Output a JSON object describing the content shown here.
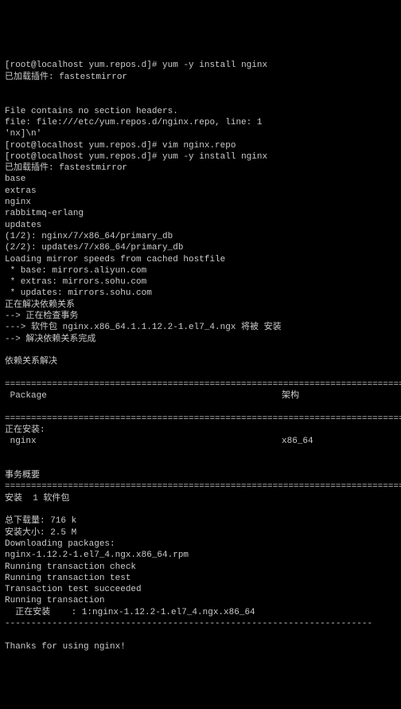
{
  "prompt1": "[root@localhost yum.repos.d]# ",
  "cmd1": "yum -y install nginx",
  "loaded_plugins": "已加载插件: fastestmirror",
  "blank": "",
  "file_no_section": "File contains no section headers.",
  "file_line": "file: file:///etc/yum.repos.d/nginx.repo, line: 1",
  "nx_line": "'nx]\\n'",
  "prompt2": "[root@localhost yum.repos.d]# ",
  "cmd2": "vim nginx.repo",
  "prompt3": "[root@localhost yum.repos.d]# ",
  "cmd3": "yum -y install nginx",
  "loaded_plugins2": "已加载插件: fastestmirror",
  "repo_base": "base",
  "repo_extras": "extras",
  "repo_nginx": "nginx",
  "repo_rabbitmq": "rabbitmq-erlang",
  "repo_updates": "updates",
  "primary1": "(1/2): nginx/7/x86_64/primary_db",
  "primary2": "(2/2): updates/7/x86_64/primary_db",
  "loading_mirror": "Loading mirror speeds from cached hostfile",
  "mirror_base": " * base: mirrors.aliyun.com",
  "mirror_extras": " * extras: mirrors.sohu.com",
  "mirror_updates": " * updates: mirrors.sohu.com",
  "resolving_deps": "正在解决依赖关系",
  "check_trans": "--> 正在检查事务",
  "pkg_install": "---> 软件包 nginx.x86_64.1.1.12.2-1.el7_4.ngx 将被 安装",
  "dep_done": "--> 解决依赖关系完成",
  "deps_resolved": "依赖关系解决",
  "hr_line": "=====================================================================================",
  "col_package": " Package",
  "col_arch": "架构",
  "installing": "正在安装:",
  "pkg_name": " nginx",
  "pkg_arch": "x86_64",
  "trans_summary": "事务概要",
  "install_count": "安装  1 软件包",
  "total_download": "总下载量: 716 k",
  "install_size": "安装大小: 2.5 M",
  "downloading": "Downloading packages:",
  "rpm_file": "nginx-1.12.2-1.el7_4.ngx.x86_64.rpm",
  "trans_check": "Running transaction check",
  "trans_test": "Running transaction test",
  "trans_succeeded": "Transaction test succeeded",
  "running_trans": "Running transaction",
  "installing_pkg": "  正在安装    : 1:nginx-1.12.2-1.el7_4.ngx.x86_64",
  "dashes": "----------------------------------------------------------------------",
  "thanks": "Thanks for using nginx!"
}
